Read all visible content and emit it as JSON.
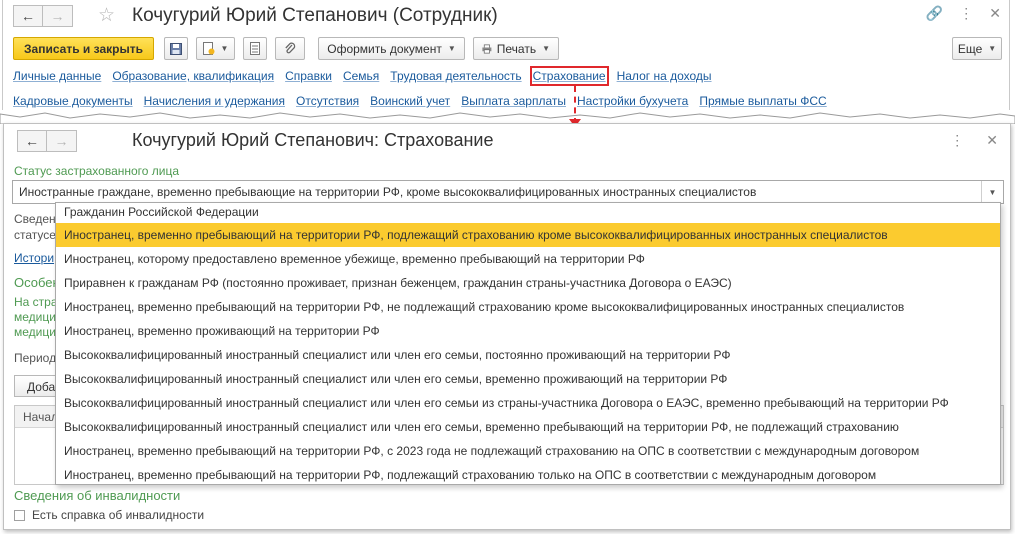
{
  "employee_window": {
    "title": "Кочугурий Юрий Степанович (Сотрудник)",
    "toolbar": {
      "save_close": "Записать и закрыть",
      "make_document": "Оформить документ",
      "print": "Печать",
      "more": "Еще"
    },
    "links_row1": [
      "Личные данные",
      "Образование, квалификация",
      "Справки",
      "Семья",
      "Трудовая деятельность",
      "Страхование",
      "Налог на доходы"
    ],
    "links_row2": [
      "Кадровые документы",
      "Начисления и удержания",
      "Отсутствия",
      "Воинский учет",
      "Выплата зарплаты",
      "Настройки бухучета",
      "Прямые выплаты ФСС"
    ],
    "active_link": "Страхование"
  },
  "insurance_window": {
    "title": "Кочугурий Юрий Степанович: Страхование",
    "status_label": "Статус застрахованного лица",
    "status_value": "Иностранные граждане, временно пребывающие на территории РФ, кроме высококвалифицированных иностранных специалистов",
    "background": {
      "info_line1": "Сведен",
      "info_line2": "статусе",
      "history_link": "Истори",
      "features_title": "Особен",
      "features_line1": "На стра",
      "features_line2": "медици",
      "features_line3": "медици",
      "periods_label": "Период",
      "add_button": "Добав",
      "table_header": "Начал"
    },
    "disability_title": "Сведения об инвалидности",
    "disability_checkbox": "Есть справка об инвалидности"
  },
  "dropdown": {
    "selected_index": 1,
    "items": [
      "Гражданин Российской Федерации",
      "Иностранец, временно пребывающий на территории РФ, подлежащий страхованию кроме высококвалифицированных иностранных специалистов",
      "Иностранец, которому предоставлено временное убежище, временно пребывающий на территории РФ",
      "Приравнен к гражданам РФ (постоянно проживает, признан беженцем, гражданин страны-участника Договора о ЕАЭС)",
      "Иностранец, временно пребывающий на территории РФ, не подлежащий страхованию кроме высококвалифицированных иностранных специалистов",
      "Иностранец, временно проживающий на территории РФ",
      "Высококвалифицированный иностранный специалист или член его семьи, постоянно проживающий на территории РФ",
      "Высококвалифицированный иностранный специалист или член его семьи, временно проживающий на территории РФ",
      "Высококвалифицированный иностранный специалист или член его семьи из страны-участника Договора о ЕАЭС, временно пребывающий на территории РФ",
      "Высококвалифицированный иностранный специалист или член его семьи, временно пребывающий на территории РФ, не подлежащий страхованию",
      "Иностранец, временно пребывающий на территории РФ, с 2023 года не подлежащий страхованию на ОПС в соответствии с международным договором",
      "Иностранец, временно пребывающий на территории РФ, подлежащий страхованию только на ОПС в соответствии с международным договором"
    ]
  }
}
